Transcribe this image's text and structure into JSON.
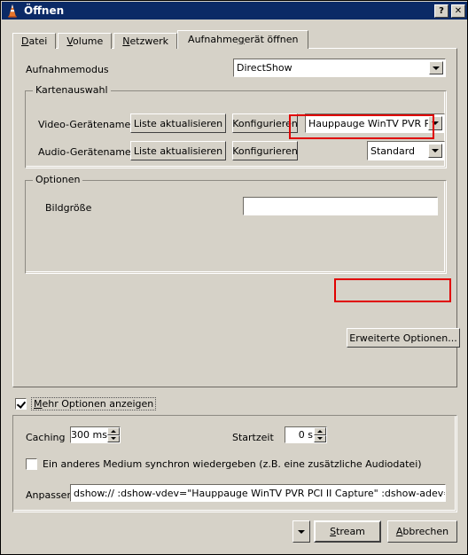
{
  "window": {
    "title": "Öffnen",
    "icon": "vlc-cone-icon",
    "help_button": "?",
    "close_button": "✕",
    "bg_color": "#d6d2c8",
    "titlebar_color": "#0b2a66",
    "highlight_color": "#e00000"
  },
  "tabs": [
    {
      "label": "Datei",
      "accel": "D",
      "active": false
    },
    {
      "label": "Volume",
      "accel": "V",
      "active": false
    },
    {
      "label": "Netzwerk",
      "accel": "N",
      "active": false
    },
    {
      "label": "Aufnahmegerät öffnen",
      "accel": "g",
      "active": true
    }
  ],
  "capture": {
    "mode_label": "Aufnahmemodus",
    "mode_value": "DirectShow",
    "card_group": {
      "title": "Kartenauswahl",
      "rows": [
        {
          "label": "Video-Gerätename",
          "refresh_label": "Liste aktualisieren",
          "configure_label": "Konfigurieren",
          "device_value": "Hauppauge WinTV PVR PCI II C",
          "highlighted": true
        },
        {
          "label": "Audio-Gerätename",
          "refresh_label": "Liste aktualisieren",
          "configure_label": "Konfigurieren",
          "device_value": "Standard",
          "highlighted": false
        }
      ]
    },
    "options_group": {
      "title": "Optionen",
      "size_label": "Bildgröße",
      "size_value": "",
      "size_placeholder": ""
    },
    "advanced_button": {
      "label": "Erweiterte Optionen...",
      "highlighted": true
    }
  },
  "more_options": {
    "checkbox_label": "Mehr Optionen anzeigen",
    "checkbox_accel": "M",
    "checked": true
  },
  "advanced_panel": {
    "caching_label": "Caching",
    "caching_value": "300 ms",
    "starttime_label": "Startzeit",
    "starttime_value": "0 s",
    "sync_checkbox_label": "Ein anderes Medium synchron wiedergeben (z.B. eine zusätzliche Audiodatei)",
    "sync_checked": false,
    "mrl_label": "Anpassen",
    "mrl_value": "dshow:// :dshow-vdev=\"Hauppauge WinTV PVR PCI II Capture\" :dshow-adev=\"\""
  },
  "footer": {
    "dropdown_arrow": "▼",
    "stream_label": "Stream",
    "stream_accel": "S",
    "cancel_label": "Abbrechen",
    "cancel_accel": "A"
  }
}
